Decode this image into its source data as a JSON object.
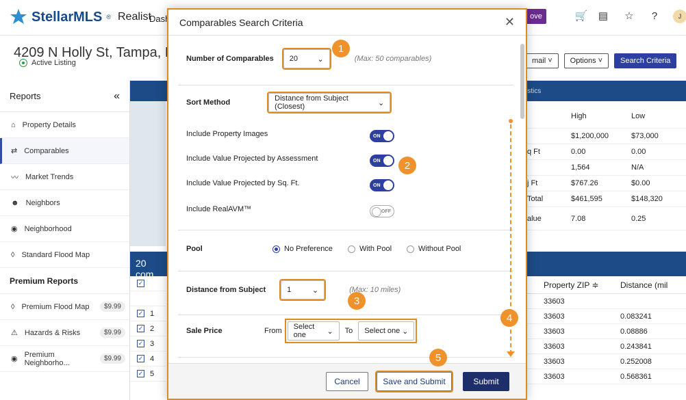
{
  "topbar": {
    "brand": "StellarMLS",
    "brand_mark": "®",
    "product": "Realist",
    "nav_dash": "Dash",
    "approve_label": "ove",
    "avatar_initial": "J",
    "icons": [
      "cart-icon",
      "document-icon",
      "star-notify-icon",
      "help-icon"
    ]
  },
  "property": {
    "address": "4209 N Holly St, Tampa, FL 3360",
    "status": "Active Listing"
  },
  "sidebar": {
    "title": "Reports",
    "collapse": "«",
    "items": [
      {
        "label": "Property Details",
        "icon": "home-icon"
      },
      {
        "label": "Comparables",
        "icon": "compare-icon",
        "active": true
      },
      {
        "label": "Market Trends",
        "icon": "trend-icon"
      },
      {
        "label": "Neighbors",
        "icon": "people-icon"
      },
      {
        "label": "Neighborhood",
        "icon": "pin-icon"
      },
      {
        "label": "Standard Flood Map",
        "icon": "drop-icon"
      }
    ],
    "premium_title": "Premium Reports",
    "premium": [
      {
        "label": "Premium Flood Map",
        "price": "$9.99",
        "icon": "drop-icon"
      },
      {
        "label": "Hazards & Risks",
        "price": "$9.99",
        "icon": "hazard-icon"
      },
      {
        "label": "Premium Neighborho...",
        "price": "$9.99",
        "icon": "pin-icon"
      }
    ]
  },
  "left_panel": {
    "comp_label": "20 com",
    "rows": [
      "1",
      "2",
      "3",
      "4",
      "5"
    ]
  },
  "right": {
    "actions": [
      "mail ˅",
      "Options ˅",
      "Search Criteria"
    ],
    "stats_band": "istics",
    "stats_head": [
      "",
      "High",
      "Low"
    ],
    "stats_rows": [
      [
        "",
        "$1,200,000",
        "$73,000"
      ],
      [
        "q Ft",
        "0.00",
        "0.00"
      ],
      [
        "",
        "1,564",
        "N/A"
      ],
      [
        "j Ft",
        "$767.26",
        "$0.00"
      ],
      [
        "Total",
        "$461,595",
        "$148,320"
      ],
      [
        "alue",
        "7.08",
        "0.25"
      ]
    ],
    "table_head": [
      "Property ZIP ≑",
      "Distance (mil"
    ],
    "table_rows": [
      [
        "33603",
        ""
      ],
      [
        "33603",
        "0.083241"
      ],
      [
        "33603",
        "0.08886"
      ],
      [
        "33603",
        "0.243841"
      ],
      [
        "33603",
        "0.252008"
      ],
      [
        "33603",
        "0.568361"
      ]
    ]
  },
  "modal": {
    "title": "Comparables Search Criteria",
    "close": "✕",
    "num_comps": {
      "label": "Number of Comparables",
      "value": "20",
      "hint": "(Max: 50 comparables)"
    },
    "sort": {
      "label": "Sort Method",
      "value": "Distance from Subject (Closest)"
    },
    "toggles": [
      {
        "label": "Include Property Images",
        "state": "ON"
      },
      {
        "label": "Include Value Projected by Assessment",
        "state": "ON"
      },
      {
        "label": "Include Value Projected by Sq. Ft.",
        "state": "ON"
      },
      {
        "label": "Include RealAVM™",
        "state": "OFF"
      }
    ],
    "pool": {
      "label": "Pool",
      "options": [
        "No Preference",
        "With Pool",
        "Without Pool"
      ],
      "selected": "No Preference"
    },
    "distance": {
      "label": "Distance from Subject",
      "value": "1",
      "hint": "(Max: 10 miles)"
    },
    "sale_price": {
      "label": "Sale Price",
      "from_label": "From",
      "to_label": "To",
      "from_value": "Select one",
      "to_value": "Select one"
    },
    "buttons": {
      "cancel": "Cancel",
      "save": "Save and Submit",
      "submit": "Submit"
    }
  },
  "badges": [
    "1",
    "2",
    "3",
    "4",
    "5"
  ],
  "colors": {
    "accent": "#f0922b",
    "primary": "#2d3fa0",
    "band": "#1d4b87"
  }
}
